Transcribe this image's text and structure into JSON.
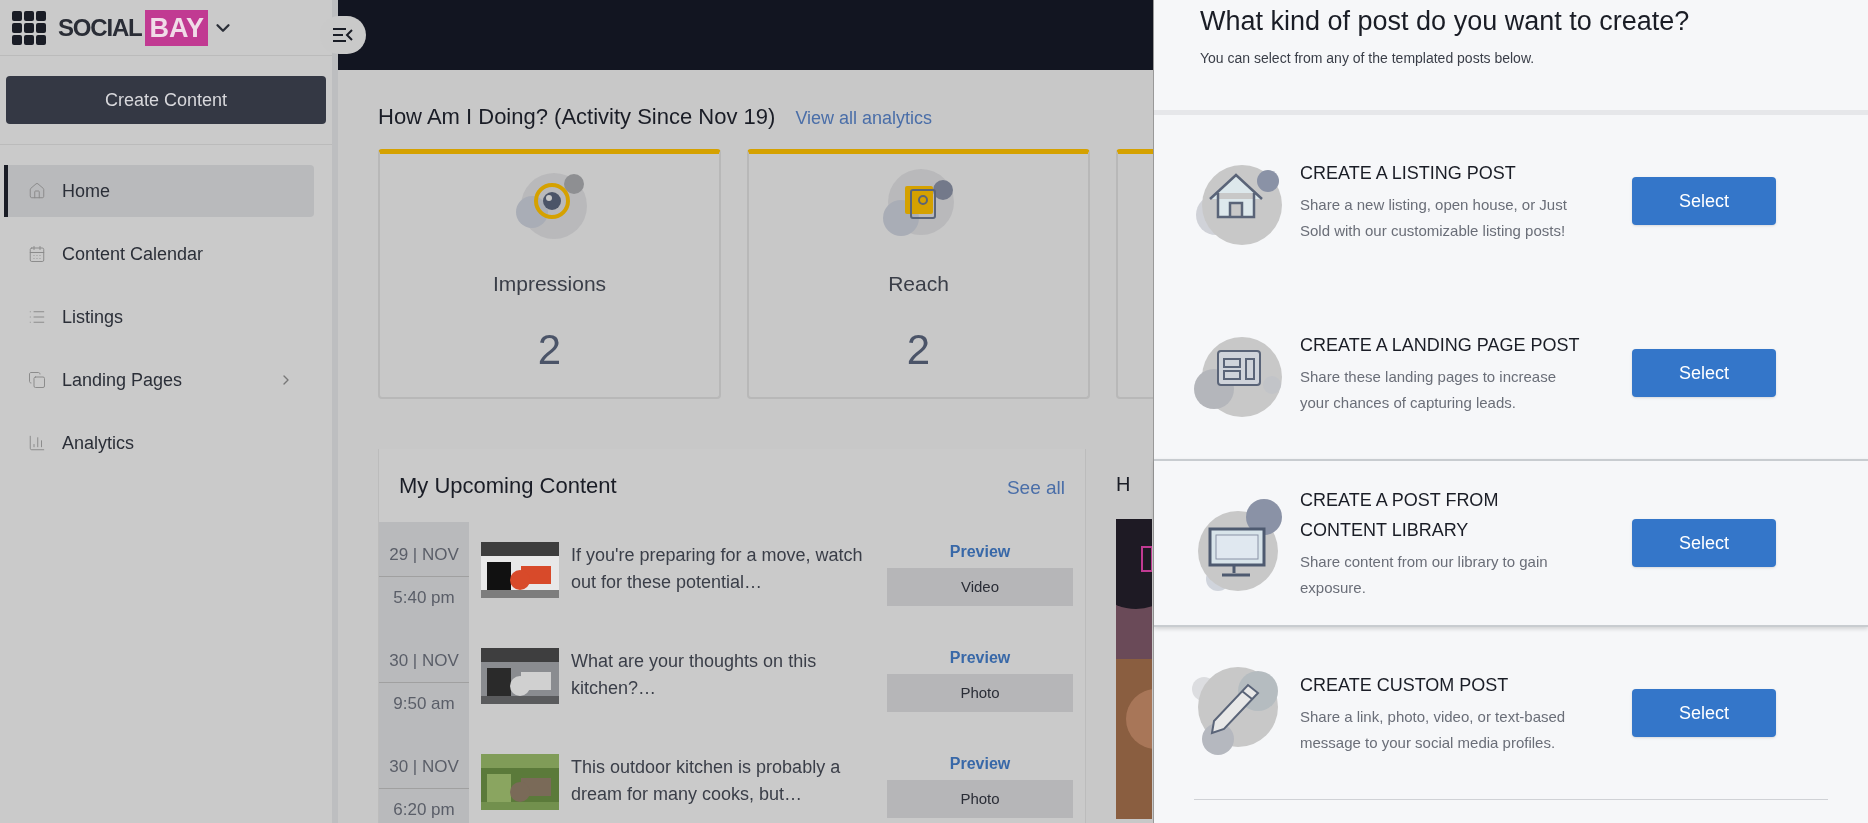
{
  "brand": {
    "word": "SOCIAL",
    "highlight": "BAY"
  },
  "sidebar": {
    "create_button": "Create Content",
    "items": [
      {
        "kind": "home",
        "label": "Home",
        "selected": true,
        "has_submenu": false
      },
      {
        "kind": "calendar",
        "label": "Content Calendar",
        "selected": false,
        "has_submenu": false
      },
      {
        "kind": "listings",
        "label": "Listings",
        "selected": false,
        "has_submenu": false
      },
      {
        "kind": "pages",
        "label": "Landing Pages",
        "selected": false,
        "has_submenu": true
      },
      {
        "kind": "analytics",
        "label": "Analytics",
        "selected": false,
        "has_submenu": false
      }
    ]
  },
  "activity": {
    "title": "How Am I Doing? (Activity Since Nov 19)",
    "link": "View all analytics",
    "cards": [
      {
        "kind": "impressions",
        "label": "Impressions",
        "value": "2"
      },
      {
        "kind": "reach",
        "label": "Reach",
        "value": "2"
      },
      {
        "kind": "hidden"
      }
    ]
  },
  "upcoming": {
    "title": "My Upcoming Content",
    "link": "See all",
    "rows": [
      {
        "date": "29 | NOV",
        "time": "5:40 pm",
        "text": "If you're preparing for a move, watch out for these potential…",
        "action": "Preview",
        "type": "Video"
      },
      {
        "date": "30 | NOV",
        "time": "9:50 am",
        "text": "What are your thoughts on this kitchen?…",
        "action": "Preview",
        "type": "Photo"
      },
      {
        "date": "30 | NOV",
        "time": "6:20 pm",
        "text": "This outdoor kitchen is probably a dream for many cooks, but…",
        "action": "Preview",
        "type": "Photo"
      }
    ]
  },
  "side_card": {
    "title": "H"
  },
  "modal": {
    "title": "What kind of post do you want to create?",
    "subtitle": "You can select from any of the templated posts below.",
    "options": [
      {
        "kind": "listing",
        "title": "CREATE A LISTING POST",
        "description": "Share a new listing, open house, or Just Sold with our customizable listing posts!",
        "button": "Select",
        "hovered": false
      },
      {
        "kind": "landing",
        "title": "CREATE A LANDING PAGE POST",
        "description": "Share these landing pages to increase your chances of capturing leads.",
        "button": "Select",
        "hovered": false
      },
      {
        "kind": "library",
        "title": "CREATE A POST FROM CONTENT LIBRARY",
        "description": "Share content from our library to gain exposure.",
        "button": "Select",
        "hovered": true
      },
      {
        "kind": "custom",
        "title": "CREATE CUSTOM POST",
        "description": "Share a link, photo, video, or text-based message to your social media profiles.",
        "button": "Select",
        "hovered": false
      }
    ]
  }
}
